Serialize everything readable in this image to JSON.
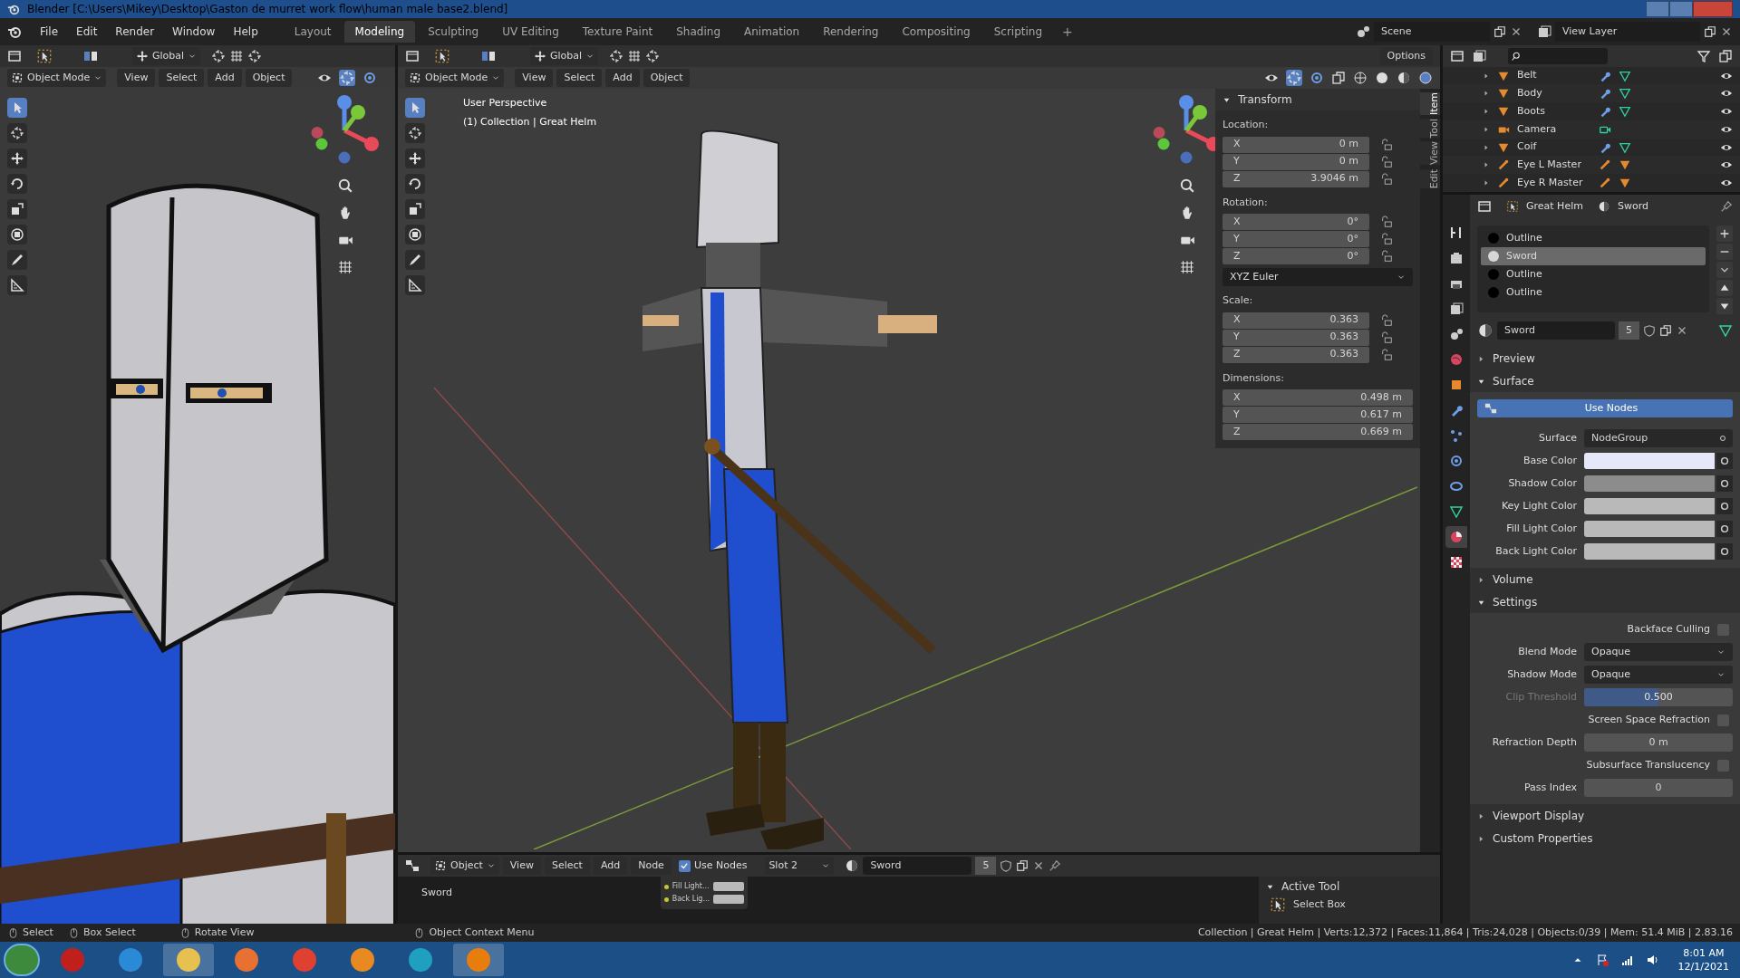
{
  "window": {
    "title": "Blender [C:\\Users\\Mikey\\Desktop\\Gaston de murret work flow\\human male base2.blend]"
  },
  "menu": [
    "File",
    "Edit",
    "Render",
    "Window",
    "Help"
  ],
  "workspaces": [
    {
      "label": "Layout",
      "selected": false
    },
    {
      "label": "Modeling",
      "selected": true
    },
    {
      "label": "Sculpting",
      "selected": false
    },
    {
      "label": "UV Editing",
      "selected": false
    },
    {
      "label": "Texture Paint",
      "selected": false
    },
    {
      "label": "Shading",
      "selected": false
    },
    {
      "label": "Animation",
      "selected": false
    },
    {
      "label": "Rendering",
      "selected": false
    },
    {
      "label": "Compositing",
      "selected": false
    },
    {
      "label": "Scripting",
      "selected": false
    }
  ],
  "add_workspace": "+",
  "scene": "Scene",
  "view_layer": "View Layer",
  "left_viewport": {
    "orientation": "Global",
    "mode": "Object Mode",
    "menus": [
      "View",
      "Select",
      "Add",
      "Object"
    ]
  },
  "main_viewport": {
    "orientation": "Global",
    "options": "Options",
    "mode": "Object Mode",
    "menus": [
      "View",
      "Select",
      "Add",
      "Object"
    ],
    "overlay": [
      "User Perspective",
      "(1) Collection | Great Helm"
    ],
    "sidebar_tabs": [
      {
        "label": "Item",
        "selected": true
      },
      {
        "label": "Tool",
        "selected": false
      },
      {
        "label": "View",
        "selected": false
      },
      {
        "label": "Edit",
        "selected": false
      }
    ],
    "transform": {
      "title": "Transform",
      "sections": [
        {
          "kind": "vector",
          "label": "Location:",
          "fields": [
            {
              "axis": "X",
              "value": "0 m",
              "locked": false
            },
            {
              "axis": "Y",
              "value": "0 m",
              "locked": false
            },
            {
              "axis": "Z",
              "value": "3.9046 m",
              "locked": false
            }
          ]
        },
        {
          "kind": "vector",
          "label": "Rotation:",
          "fields": [
            {
              "axis": "X",
              "value": "0°",
              "locked": false
            },
            {
              "axis": "Y",
              "value": "0°",
              "locked": false
            },
            {
              "axis": "Z",
              "value": "0°",
              "locked": false
            }
          ]
        },
        {
          "kind": "dropdown",
          "value": "XYZ Euler"
        },
        {
          "kind": "vector",
          "label": "Scale:",
          "fields": [
            {
              "axis": "X",
              "value": "0.363",
              "locked": false
            },
            {
              "axis": "Y",
              "value": "0.363",
              "locked": false
            },
            {
              "axis": "Z",
              "value": "0.363",
              "locked": false
            }
          ]
        },
        {
          "kind": "wide",
          "label": "Dimensions:",
          "fields": [
            {
              "axis": "X",
              "value": "0.498 m"
            },
            {
              "axis": "Y",
              "value": "0.617 m"
            },
            {
              "axis": "Z",
              "value": "0.669 m"
            }
          ]
        }
      ]
    }
  },
  "outliner": {
    "items": [
      {
        "name": "Belt",
        "kind": "mesh",
        "visible": true
      },
      {
        "name": "Body",
        "kind": "mesh",
        "visible": true
      },
      {
        "name": "Boots",
        "kind": "mesh",
        "visible": true
      },
      {
        "name": "Camera",
        "kind": "camera",
        "visible": true
      },
      {
        "name": "Coif",
        "kind": "mesh",
        "visible": true
      },
      {
        "name": "Eye L Master",
        "kind": "armature",
        "visible": true
      },
      {
        "name": "Eye R Master",
        "kind": "armature",
        "visible": true
      }
    ]
  },
  "properties": {
    "breadcrumb": [
      "Great Helm",
      "Sword"
    ],
    "tabs": [
      {
        "kind": "tool",
        "selected": false
      },
      {
        "kind": "render",
        "selected": false
      },
      {
        "kind": "output",
        "selected": false
      },
      {
        "kind": "view_layer",
        "selected": false
      },
      {
        "kind": "scene",
        "selected": false
      },
      {
        "kind": "world",
        "selected": false
      },
      {
        "kind": "object",
        "selected": false
      },
      {
        "kind": "modifier",
        "selected": false
      },
      {
        "kind": "particles",
        "selected": false
      },
      {
        "kind": "physics",
        "selected": false
      },
      {
        "kind": "constraints",
        "selected": false
      },
      {
        "kind": "data",
        "selected": false
      },
      {
        "kind": "material",
        "selected": true
      },
      {
        "kind": "texture",
        "selected": false
      }
    ],
    "slots": [
      {
        "name": "Outline",
        "selected": false,
        "color": "#000000"
      },
      {
        "name": "Sword",
        "selected": true,
        "color": "#d6d6d6"
      },
      {
        "name": "Outline",
        "selected": false,
        "color": "#000000"
      },
      {
        "name": "Outline",
        "selected": false,
        "color": "#000000"
      }
    ],
    "material": "Sword",
    "users": "5",
    "panels": [
      {
        "title": "Preview",
        "expanded": false
      },
      {
        "title": "Surface",
        "expanded": true,
        "use_nodes": "Use Nodes",
        "rows": [
          {
            "kind": "shader",
            "label": "Surface",
            "value": "NodeGroup"
          },
          {
            "kind": "color",
            "label": "Base Color",
            "color": "#e6e8fa"
          },
          {
            "kind": "color",
            "label": "Shadow Color",
            "color": "#8c8c8c"
          },
          {
            "kind": "color",
            "label": "Key Light Color",
            "color": "#b9b9b9"
          },
          {
            "kind": "color",
            "label": "Fill Light Color",
            "color": "#b9b9b9"
          },
          {
            "kind": "color",
            "label": "Back Light Color",
            "color": "#b9b9b9"
          }
        ]
      },
      {
        "title": "Volume",
        "expanded": false
      },
      {
        "title": "Settings",
        "expanded": true,
        "rows": [
          {
            "kind": "checkbox",
            "label": "Backface Culling",
            "checked": false
          },
          {
            "kind": "dropdown",
            "label": "Blend Mode",
            "value": "Opaque"
          },
          {
            "kind": "dropdown",
            "label": "Shadow Mode",
            "value": "Opaque"
          },
          {
            "kind": "slider",
            "label": "Clip Threshold",
            "value": "0.500",
            "level": 0.5,
            "disabled": true
          },
          {
            "kind": "checkbox",
            "label": "Screen Space Refraction",
            "checked": false
          },
          {
            "kind": "number",
            "label": "Refraction Depth",
            "value": "0 m"
          },
          {
            "kind": "checkbox",
            "label": "Subsurface Translucency",
            "checked": false
          },
          {
            "kind": "number",
            "label": "Pass Index",
            "value": "0"
          }
        ]
      },
      {
        "title": "Viewport Display",
        "expanded": false
      },
      {
        "title": "Custom Properties",
        "expanded": false
      }
    ]
  },
  "node_editor": {
    "mode": "Object",
    "menus": [
      "View",
      "Select",
      "Add",
      "Node"
    ],
    "use_nodes": {
      "label": "Use Nodes",
      "checked": true
    },
    "slot": "Slot 2",
    "material": "Sword",
    "users": "5",
    "breadcrumb": "Sword",
    "sockets": [
      "Fill Light...",
      "Back Lig..."
    ],
    "active_tool": {
      "title": "Active Tool",
      "tool": "Select Box"
    }
  },
  "status_bar": {
    "hints": [
      "Select",
      "Box Select",
      "Rotate View",
      "Object Context Menu"
    ],
    "stats": "Collection | Great Helm | Verts:12,372 | Faces:11,864 | Tris:24,028 | Objects:0/39 | Mem: 51.4 MiB | 2.83.16"
  },
  "taskbar": {
    "time": "8:01 AM",
    "date": "12/1/2021"
  }
}
